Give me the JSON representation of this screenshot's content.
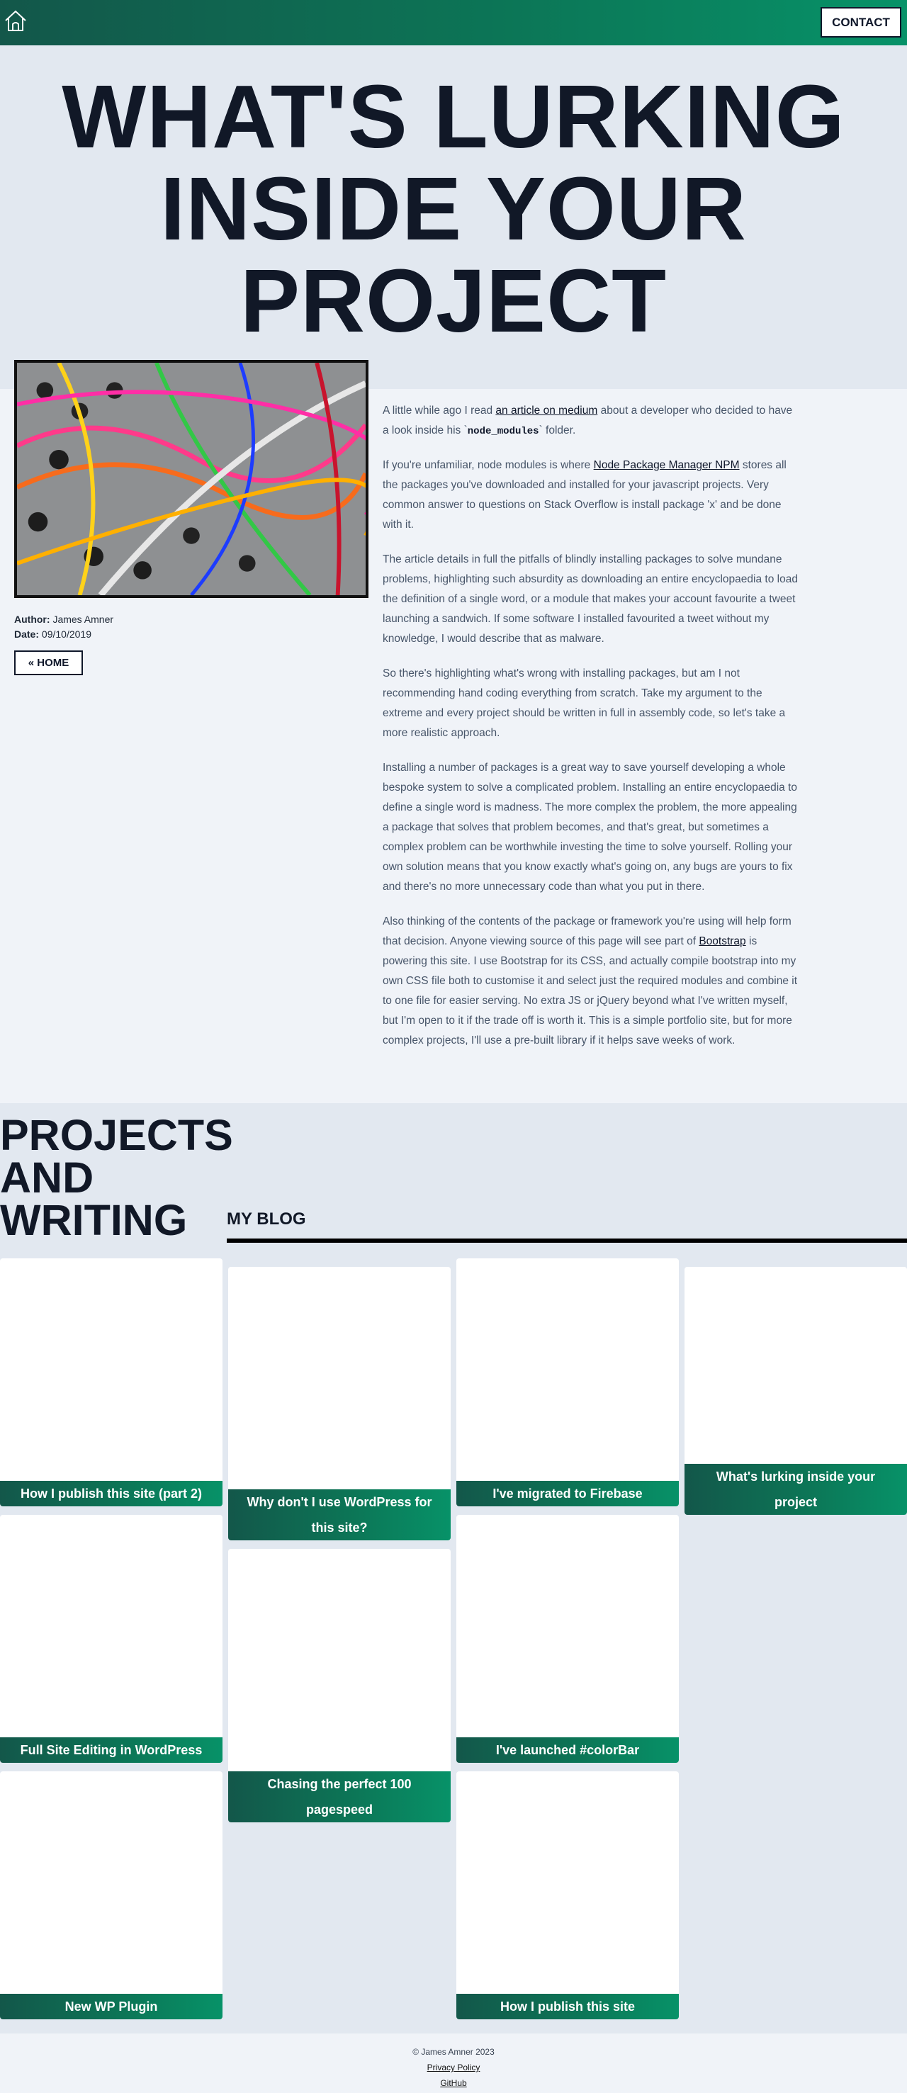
{
  "nav": {
    "home_icon": "home-icon",
    "contact_label": "CONTACT"
  },
  "hero": {
    "title_line1": "WHAT'S LURKING",
    "title_line2": "INSIDE YOUR",
    "title_line3": "PROJECT"
  },
  "post": {
    "author_label": "Author:",
    "author": "James Amner",
    "date_label": "Date:",
    "date": "09/10/2019",
    "home_button": "« HOME",
    "p1": {
      "a": "A little while ago I read ",
      "link": "an article on medium",
      "b": " about a developer who decided to have a look inside his `",
      "code": "node_modules",
      "c": "` folder."
    },
    "p2": {
      "a": "If you're unfamiliar, node modules is where ",
      "link": "Node Package Manager NPM",
      "b": " stores all the packages you've downloaded and installed for your javascript projects. Very common answer to questions on Stack Overflow is install package 'x' and be done with it."
    },
    "p3": "The article details in full the pitfalls of blindly installing packages to solve mundane problems, highlighting such absurdity as downloading an entire encyclopaedia to load the definition of a single word, or a module that makes your account favourite a tweet launching a sandwich. If some software I installed favourited a tweet without my knowledge, I would describe that as malware.",
    "p4": "So there's highlighting what's wrong with installing packages, but am I not recommending hand coding everything from scratch. Take my argument to the extreme and every project should be written in full in assembly code, so let's take a more realistic approach.",
    "p5": "Installing a number of packages is a great way to save yourself developing a whole bespoke system to solve a complicated problem. Installing an entire encyclopaedia to define a single word is madness. The more complex the problem, the more appealing a package that solves that problem becomes, and that's great, but sometimes a complex problem can be worthwhile investing the time to solve yourself. Rolling your own solution means that you know exactly what's going on, any bugs are yours to fix and there's no more unnecessary code than what you put in there.",
    "p6": {
      "a": "Also thinking of the contents of the package or framework you're using will help form that decision. Anyone viewing source of this page will see part of ",
      "link": "Bootstrap",
      "b": " is powering this site. I use Bootstrap for its CSS, and actually compile bootstrap into my own CSS file both to customise it and select just the required modules and combine it to one file for easier serving. No extra JS or jQuery beyond what I've written myself, but I'm open to it if the trade off is worth it. This is a simple portfolio site, but for more complex projects, I'll use a pre-built library if it helps save weeks of work."
    }
  },
  "projects": {
    "title_line1": "PROJECTS",
    "title_line2": "AND",
    "title_line3": "WRITING",
    "blog_label": "MY BLOG",
    "cards": [
      {
        "title": "How I publish this site (part 2)"
      },
      {
        "title": "Why don't I use WordPress for this site?"
      },
      {
        "title": "I've migrated to Firebase"
      },
      {
        "title": "What's lurking inside your project"
      },
      {
        "title": "Full Site Editing in WordPress"
      },
      {
        "title": "Chasing the perfect 100 pagespeed"
      },
      {
        "title": "I've launched #colorBar"
      },
      {
        "title": "New WP Plugin"
      },
      {
        "title": "How I publish this site"
      }
    ]
  },
  "footer": {
    "copyright": "© James Amner 2023",
    "privacy": "Privacy Policy",
    "github": "GitHub"
  },
  "colors": {
    "accent_start": "#13574a",
    "accent_end": "#079268",
    "page_bg": "#e2e8f0",
    "panel_bg": "#f0f3f8"
  }
}
